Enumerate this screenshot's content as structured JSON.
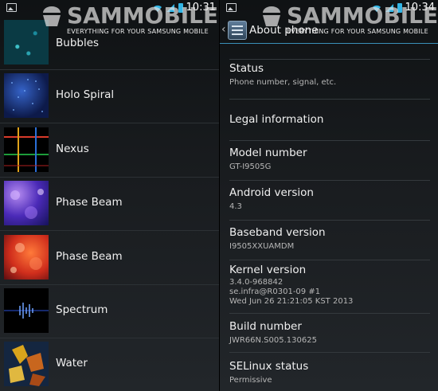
{
  "watermark": {
    "name": "SAMMOBILE",
    "tagline": "EVERYTHING FOR YOUR SAMSUNG MOBILE"
  },
  "left_status": {
    "time": "10:31"
  },
  "right_status": {
    "time": "10:34"
  },
  "wallpapers": [
    {
      "label": "Bubbles"
    },
    {
      "label": "Holo Spiral"
    },
    {
      "label": "Nexus"
    },
    {
      "label": "Phase Beam"
    },
    {
      "label": "Phase Beam"
    },
    {
      "label": "Spectrum"
    },
    {
      "label": "Water"
    }
  ],
  "about": {
    "title": "About phone",
    "items": [
      {
        "title": "Status",
        "sub": "Phone number, signal, etc."
      },
      {
        "title": "Legal information",
        "sub": ""
      },
      {
        "title": "Model number",
        "sub": "GT-I9505G"
      },
      {
        "title": "Android version",
        "sub": "4.3"
      },
      {
        "title": "Baseband version",
        "sub": "I9505XXUAMDM"
      },
      {
        "title": "Kernel version",
        "sub": "3.4.0-968842\nse.infra@R0301-09 #1\nWed Jun 26 21:21:05 KST 2013"
      },
      {
        "title": "Build number",
        "sub": "JWR66N.S005.130625"
      },
      {
        "title": "SELinux status",
        "sub": "Permissive"
      }
    ]
  },
  "colors": {
    "accent": "#33b5e5"
  }
}
